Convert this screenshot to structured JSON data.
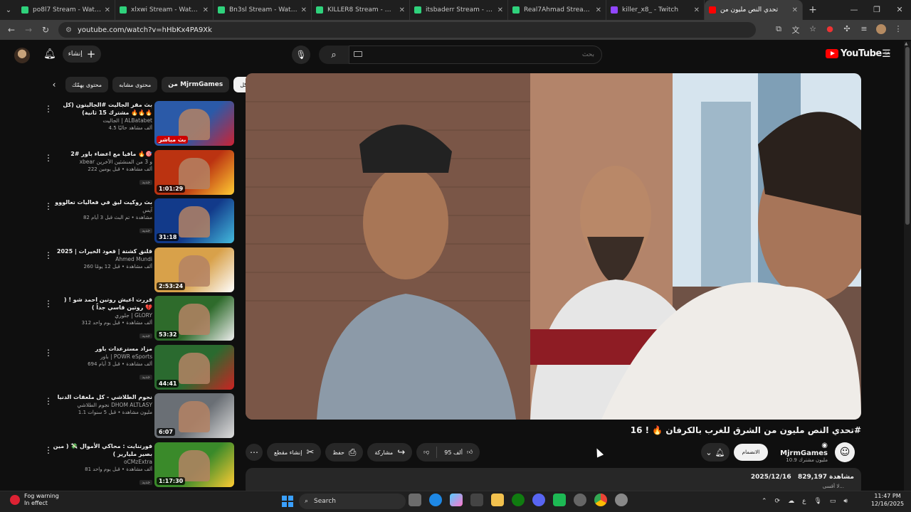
{
  "browser": {
    "tabs": [
      {
        "title": "po8l7 Stream - Watch Live",
        "color": "#2fd27c"
      },
      {
        "title": "xlxwi Stream - Watch Live",
        "color": "#2fd27c"
      },
      {
        "title": "Bn3sl Stream - Watch Live",
        "color": "#2fd27c"
      },
      {
        "title": "KILLER8 Stream - Watch",
        "color": "#2fd27c"
      },
      {
        "title": "itsbaderr Stream - Watch",
        "color": "#2fd27c"
      },
      {
        "title": "Real7Ahmad Stream - W",
        "color": "#2fd27c"
      },
      {
        "title": "killer_x8_ - Twitch",
        "color": "#9146ff"
      },
      {
        "title": "تحدي النص مليون من",
        "color": "#ff0000",
        "active": true
      }
    ],
    "url": "youtube.com/watch?v=hHbKx4PA9Xk"
  },
  "youtube": {
    "create_label": "إنشاء",
    "search_placeholder": "بحث",
    "logo_text": "YouTube",
    "region": "SA",
    "chips": [
      {
        "label": "الكل",
        "selected": true
      },
      {
        "label": "من MjrmGames",
        "bold": true
      },
      {
        "label": "محتوى مشابه"
      },
      {
        "label": "محتوى يهمّك"
      }
    ],
    "recommendations": [
      {
        "title": "بث مقر الجاليت #الجاليتون (كل مشترك 15 ثانية) 🔥🔥🔥",
        "channel": "الجاليت | ALBatabet",
        "stats": "4.5 ألف مشاهد حاليًا",
        "badge": "",
        "duration": "",
        "live": "بث مباشر"
      },
      {
        "title": "مافيا مع اعضاء باور #2 🔥🎯",
        "channel": "xbear و 3 من المنشئين الآخرين",
        "stats": "222 ألف مشاهدة • قبل يومين",
        "badge": "جديد",
        "duration": "1:01:29"
      },
      {
        "title": "بث روكيت ليق في فعاليات تعالووو",
        "channel": "آيس",
        "stats": "82 مشاهدة • تم البث قبل 3 أيام",
        "badge": "جديد",
        "duration": "31:18"
      },
      {
        "title": "قلنق كشتة | قعود الخيرات | 2025",
        "channel": "Ahmed Mundi",
        "stats": "260 ألف مشاهدة • قبل 12 يومًا",
        "badge": "",
        "duration": "2:53:24"
      },
      {
        "title": "قررت اعيش روتين احمد شو ! ( روتين قاسي جداً ) 💔",
        "channel": "جلوري | GLORY",
        "stats": "312 ألف مشاهدة • قبل يوم واحد",
        "badge": "جديد",
        "duration": "53:32"
      },
      {
        "title": "مزاد مسترعدات باور",
        "channel": "باور | POWR eSports",
        "stats": "694 ألف مشاهدة • قبل 3 أيام",
        "badge": "جديد",
        "duration": "44:41"
      },
      {
        "title": "نجوم الطلاشي - كل ملعقات الدنيا",
        "channel": "نجوم الطلاشي DHOM ALTLASY",
        "stats": "1.1 مليون مشاهدة • قبل 5 سنوات",
        "badge": "",
        "duration": "6:07"
      },
      {
        "title": "فورتنايت : محاكي الأموال 💸 ( مين بصير مليارير )",
        "channel": "oCMzExtra",
        "stats": "81 ألف مشاهدة • قبل يوم واحد",
        "badge": "جديد",
        "duration": "1:17:30"
      }
    ],
    "video": {
      "title": "تحدي النص مليون من الشرق للغرب بالكرفان 🔥 ! 16#",
      "channel": "MjrmGames",
      "subscribers": "10.9 مليون مشترك",
      "join_label": "الانضمام",
      "likes": "95 ألف",
      "share_label": "مشاركة",
      "save_label": "حفظ",
      "clip_label": "إنشاء مقطع",
      "views": "829,197 مشاهدة",
      "date": "2025/12/16",
      "desc_more": "لا أقسى..."
    }
  },
  "taskbar": {
    "fog_title": "Fog warning",
    "fog_sub": "In effect",
    "search_label": "Search",
    "time": "11:47 PM",
    "date": "12/16/2025",
    "lang": "ع"
  }
}
